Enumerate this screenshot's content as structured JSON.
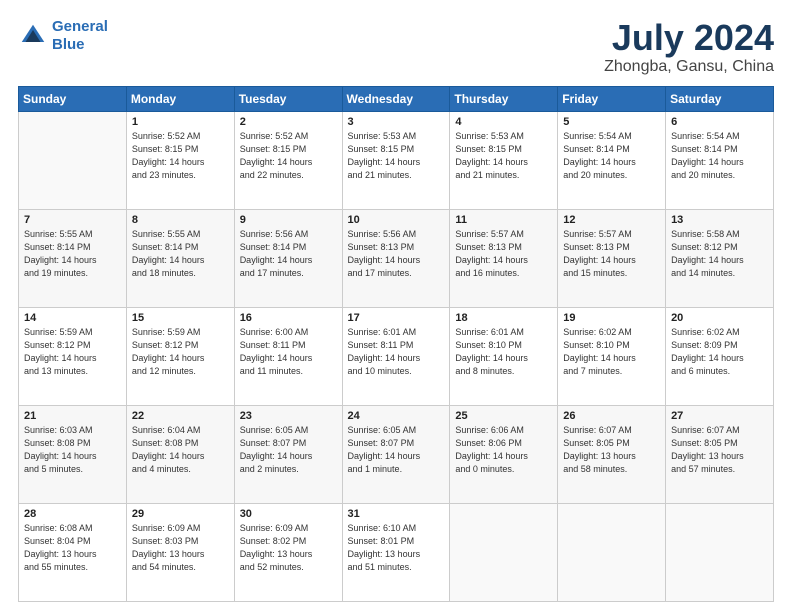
{
  "header": {
    "logo_line1": "General",
    "logo_line2": "Blue",
    "title": "July 2024",
    "subtitle": "Zhongba, Gansu, China"
  },
  "days_of_week": [
    "Sunday",
    "Monday",
    "Tuesday",
    "Wednesday",
    "Thursday",
    "Friday",
    "Saturday"
  ],
  "weeks": [
    [
      {
        "day": "",
        "info": ""
      },
      {
        "day": "1",
        "info": "Sunrise: 5:52 AM\nSunset: 8:15 PM\nDaylight: 14 hours\nand 23 minutes."
      },
      {
        "day": "2",
        "info": "Sunrise: 5:52 AM\nSunset: 8:15 PM\nDaylight: 14 hours\nand 22 minutes."
      },
      {
        "day": "3",
        "info": "Sunrise: 5:53 AM\nSunset: 8:15 PM\nDaylight: 14 hours\nand 21 minutes."
      },
      {
        "day": "4",
        "info": "Sunrise: 5:53 AM\nSunset: 8:15 PM\nDaylight: 14 hours\nand 21 minutes."
      },
      {
        "day": "5",
        "info": "Sunrise: 5:54 AM\nSunset: 8:14 PM\nDaylight: 14 hours\nand 20 minutes."
      },
      {
        "day": "6",
        "info": "Sunrise: 5:54 AM\nSunset: 8:14 PM\nDaylight: 14 hours\nand 20 minutes."
      }
    ],
    [
      {
        "day": "7",
        "info": "Sunrise: 5:55 AM\nSunset: 8:14 PM\nDaylight: 14 hours\nand 19 minutes."
      },
      {
        "day": "8",
        "info": "Sunrise: 5:55 AM\nSunset: 8:14 PM\nDaylight: 14 hours\nand 18 minutes."
      },
      {
        "day": "9",
        "info": "Sunrise: 5:56 AM\nSunset: 8:14 PM\nDaylight: 14 hours\nand 17 minutes."
      },
      {
        "day": "10",
        "info": "Sunrise: 5:56 AM\nSunset: 8:13 PM\nDaylight: 14 hours\nand 17 minutes."
      },
      {
        "day": "11",
        "info": "Sunrise: 5:57 AM\nSunset: 8:13 PM\nDaylight: 14 hours\nand 16 minutes."
      },
      {
        "day": "12",
        "info": "Sunrise: 5:57 AM\nSunset: 8:13 PM\nDaylight: 14 hours\nand 15 minutes."
      },
      {
        "day": "13",
        "info": "Sunrise: 5:58 AM\nSunset: 8:12 PM\nDaylight: 14 hours\nand 14 minutes."
      }
    ],
    [
      {
        "day": "14",
        "info": "Sunrise: 5:59 AM\nSunset: 8:12 PM\nDaylight: 14 hours\nand 13 minutes."
      },
      {
        "day": "15",
        "info": "Sunrise: 5:59 AM\nSunset: 8:12 PM\nDaylight: 14 hours\nand 12 minutes."
      },
      {
        "day": "16",
        "info": "Sunrise: 6:00 AM\nSunset: 8:11 PM\nDaylight: 14 hours\nand 11 minutes."
      },
      {
        "day": "17",
        "info": "Sunrise: 6:01 AM\nSunset: 8:11 PM\nDaylight: 14 hours\nand 10 minutes."
      },
      {
        "day": "18",
        "info": "Sunrise: 6:01 AM\nSunset: 8:10 PM\nDaylight: 14 hours\nand 8 minutes."
      },
      {
        "day": "19",
        "info": "Sunrise: 6:02 AM\nSunset: 8:10 PM\nDaylight: 14 hours\nand 7 minutes."
      },
      {
        "day": "20",
        "info": "Sunrise: 6:02 AM\nSunset: 8:09 PM\nDaylight: 14 hours\nand 6 minutes."
      }
    ],
    [
      {
        "day": "21",
        "info": "Sunrise: 6:03 AM\nSunset: 8:08 PM\nDaylight: 14 hours\nand 5 minutes."
      },
      {
        "day": "22",
        "info": "Sunrise: 6:04 AM\nSunset: 8:08 PM\nDaylight: 14 hours\nand 4 minutes."
      },
      {
        "day": "23",
        "info": "Sunrise: 6:05 AM\nSunset: 8:07 PM\nDaylight: 14 hours\nand 2 minutes."
      },
      {
        "day": "24",
        "info": "Sunrise: 6:05 AM\nSunset: 8:07 PM\nDaylight: 14 hours\nand 1 minute."
      },
      {
        "day": "25",
        "info": "Sunrise: 6:06 AM\nSunset: 8:06 PM\nDaylight: 14 hours\nand 0 minutes."
      },
      {
        "day": "26",
        "info": "Sunrise: 6:07 AM\nSunset: 8:05 PM\nDaylight: 13 hours\nand 58 minutes."
      },
      {
        "day": "27",
        "info": "Sunrise: 6:07 AM\nSunset: 8:05 PM\nDaylight: 13 hours\nand 57 minutes."
      }
    ],
    [
      {
        "day": "28",
        "info": "Sunrise: 6:08 AM\nSunset: 8:04 PM\nDaylight: 13 hours\nand 55 minutes."
      },
      {
        "day": "29",
        "info": "Sunrise: 6:09 AM\nSunset: 8:03 PM\nDaylight: 13 hours\nand 54 minutes."
      },
      {
        "day": "30",
        "info": "Sunrise: 6:09 AM\nSunset: 8:02 PM\nDaylight: 13 hours\nand 52 minutes."
      },
      {
        "day": "31",
        "info": "Sunrise: 6:10 AM\nSunset: 8:01 PM\nDaylight: 13 hours\nand 51 minutes."
      },
      {
        "day": "",
        "info": ""
      },
      {
        "day": "",
        "info": ""
      },
      {
        "day": "",
        "info": ""
      }
    ]
  ]
}
